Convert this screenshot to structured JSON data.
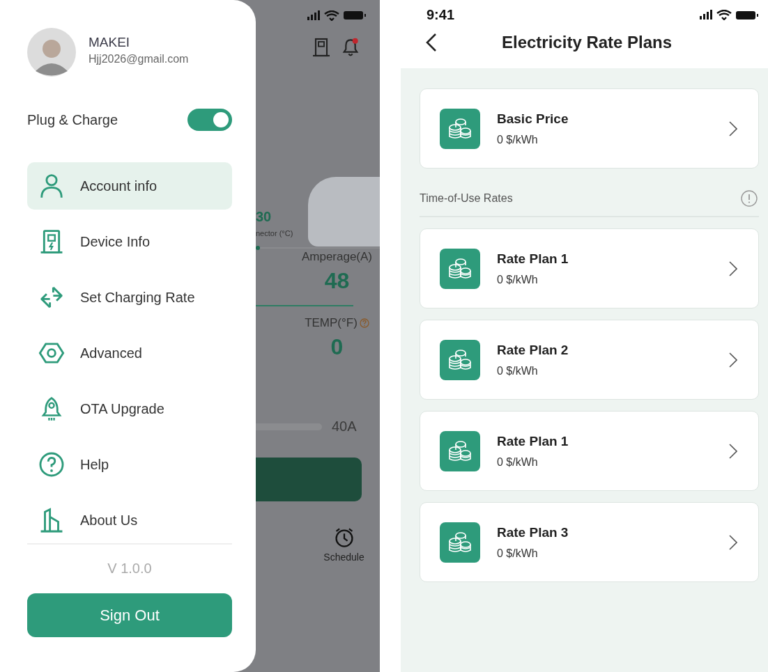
{
  "drawer": {
    "user": {
      "name": "MAKEI",
      "email": "Hjj2026@gmail.com"
    },
    "plug_and_charge": {
      "label": "Plug & Charge",
      "on": true
    },
    "menu": [
      {
        "label": "Account info",
        "selected": true
      },
      {
        "label": "Device Info",
        "selected": false
      },
      {
        "label": "Set Charging Rate",
        "selected": false
      },
      {
        "label": "Advanced",
        "selected": false
      },
      {
        "label": "OTA Upgrade",
        "selected": false
      },
      {
        "label": "Help",
        "selected": false
      },
      {
        "label": "About Us",
        "selected": false
      }
    ],
    "version": "V 1.0.0",
    "sign_out": "Sign Out"
  },
  "background_screen": {
    "connector_value": "30",
    "connector_label": "nector (°C)",
    "amperage_label": "Amperage(A)",
    "amperage_value": "48",
    "temp_label": "TEMP(°F)",
    "temp_value": "0",
    "limit": "40A",
    "tab_label": "Schedule"
  },
  "rate_screen": {
    "time": "9:41",
    "title": "Electricity Rate Plans",
    "basic": {
      "name": "Basic Price",
      "price": "0 $/kWh"
    },
    "section_title": "Time-of-Use Rates",
    "plans": [
      {
        "name": "Rate Plan 1",
        "price": "0 $/kWh"
      },
      {
        "name": "Rate Plan 2",
        "price": "0 $/kWh"
      },
      {
        "name": "Rate Plan 1",
        "price": "0 $/kWh"
      },
      {
        "name": "Rate Plan 3",
        "price": "0 $/kWh"
      }
    ]
  }
}
